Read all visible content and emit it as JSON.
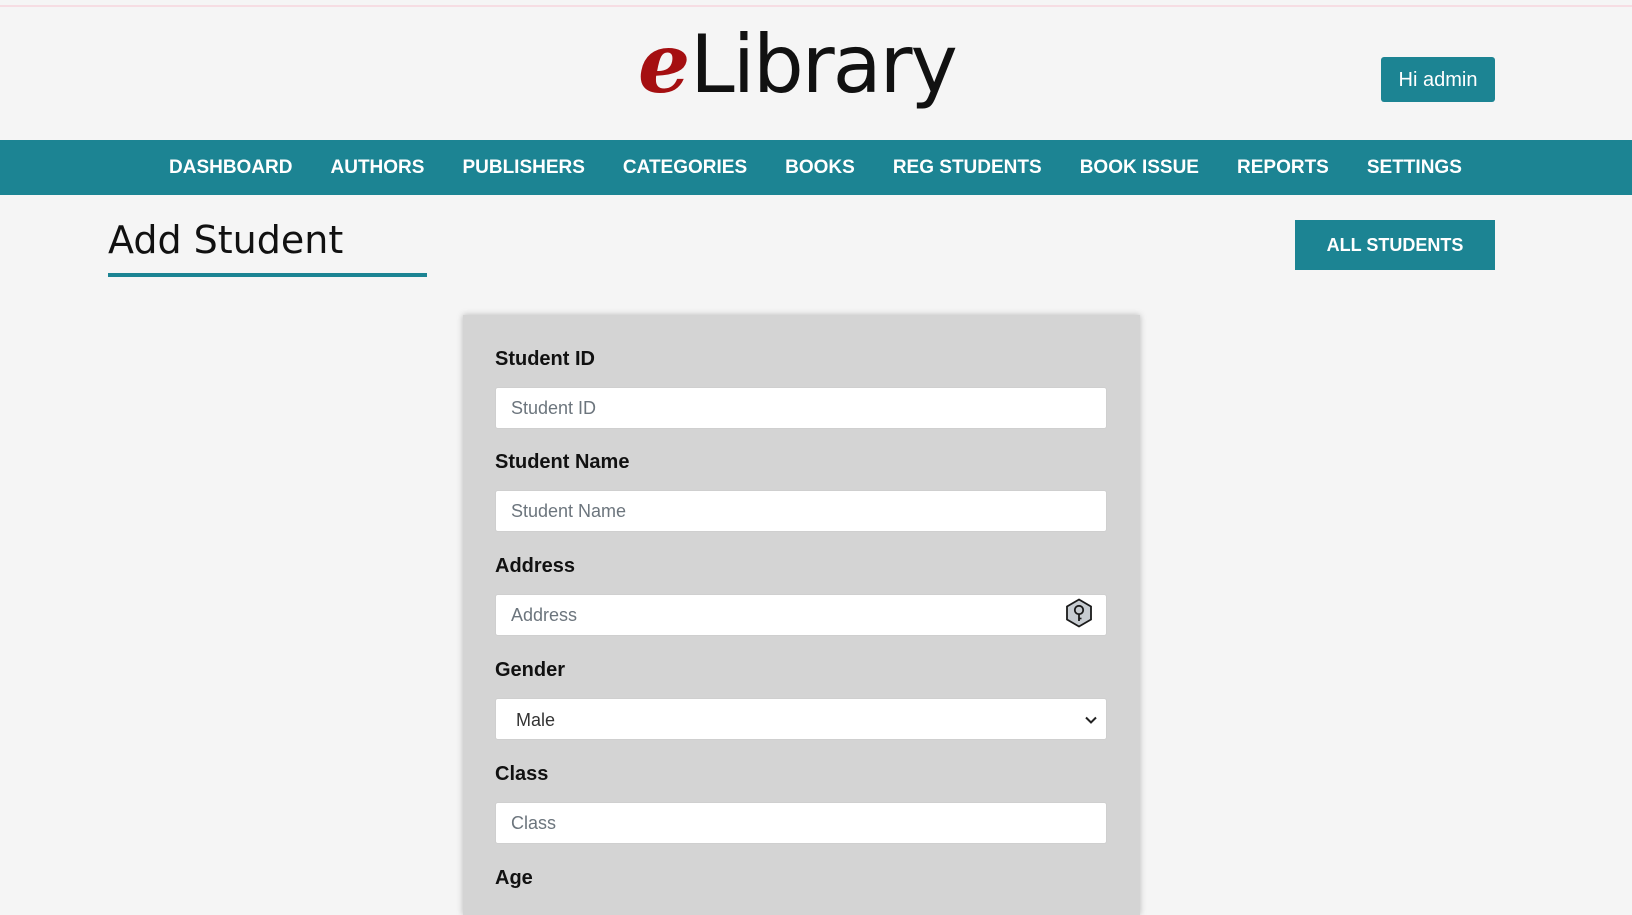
{
  "header": {
    "logo_prefix": "e",
    "logo_suffix": "Library",
    "user_button": "Hi admin"
  },
  "nav": {
    "items": [
      "DASHBOARD",
      "AUTHORS",
      "PUBLISHERS",
      "CATEGORIES",
      "BOOKS",
      "REG STUDENTS",
      "BOOK ISSUE",
      "REPORTS",
      "SETTINGS"
    ]
  },
  "page": {
    "title": "Add Student",
    "all_students_button": "ALL STUDENTS"
  },
  "form": {
    "student_id": {
      "label": "Student ID",
      "placeholder": "Student ID",
      "value": ""
    },
    "student_name": {
      "label": "Student Name",
      "placeholder": "Student Name",
      "value": ""
    },
    "address": {
      "label": "Address",
      "placeholder": "Address",
      "value": "",
      "icon": "password-manager-key-icon"
    },
    "gender": {
      "label": "Gender",
      "selected": "Male",
      "icon": "chevron-down-icon"
    },
    "class": {
      "label": "Class",
      "placeholder": "Class",
      "value": ""
    },
    "age": {
      "label": "Age"
    }
  },
  "colors": {
    "accent": "#1c8493",
    "logo_red": "#a50f11",
    "background": "#f5f5f5",
    "card": "#d4d4d4"
  }
}
